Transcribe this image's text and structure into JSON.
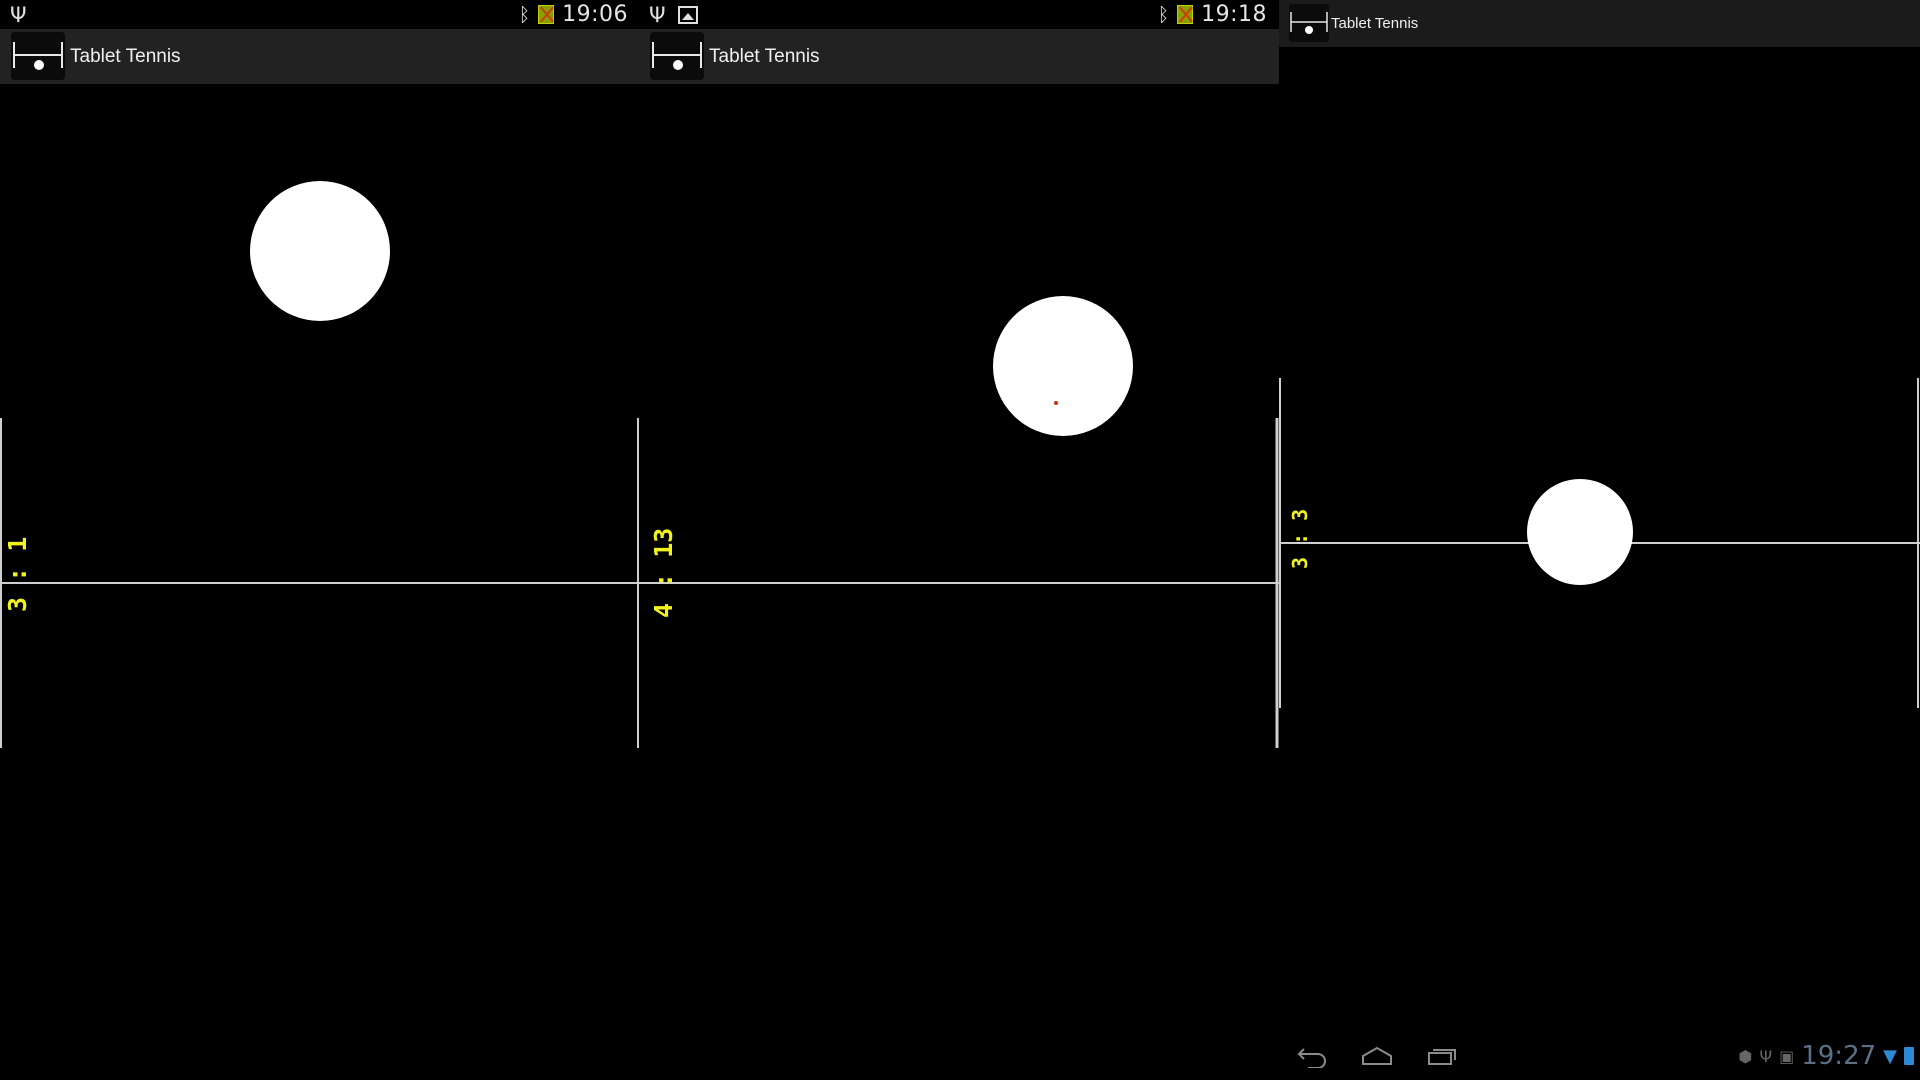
{
  "colors": {
    "background": "#000000",
    "action_bar": "#222223",
    "score_text": "#f2f21e",
    "ball": "#ffffff",
    "court_lines": "#cfcfcf",
    "status_accent": "#2d8bd6"
  },
  "panels": [
    {
      "status": {
        "time": "19:06",
        "icons": [
          "usb-icon",
          "bluetooth-icon",
          "battery-error-icon"
        ]
      },
      "app": {
        "title": "Tablet Tennis",
        "icon": "tablet-tennis-app-icon"
      },
      "score": "3 : 1"
    },
    {
      "status": {
        "time": "19:18",
        "icons": [
          "usb-icon",
          "image-icon",
          "bluetooth-icon",
          "battery-error-icon"
        ]
      },
      "app": {
        "title": "Tablet Tennis",
        "icon": "tablet-tennis-app-icon"
      },
      "score": "4 : 13"
    },
    {
      "app": {
        "title": "Tablet Tennis",
        "icon": "tablet-tennis-app-icon"
      },
      "score": "3 : 3",
      "navigation": {
        "buttons": [
          "back-icon",
          "home-icon",
          "recent-apps-icon"
        ],
        "time": "19:27",
        "icons": [
          "android-debug-icon",
          "usb-icon",
          "image-icon",
          "wifi-icon",
          "battery-icon"
        ]
      }
    }
  ]
}
